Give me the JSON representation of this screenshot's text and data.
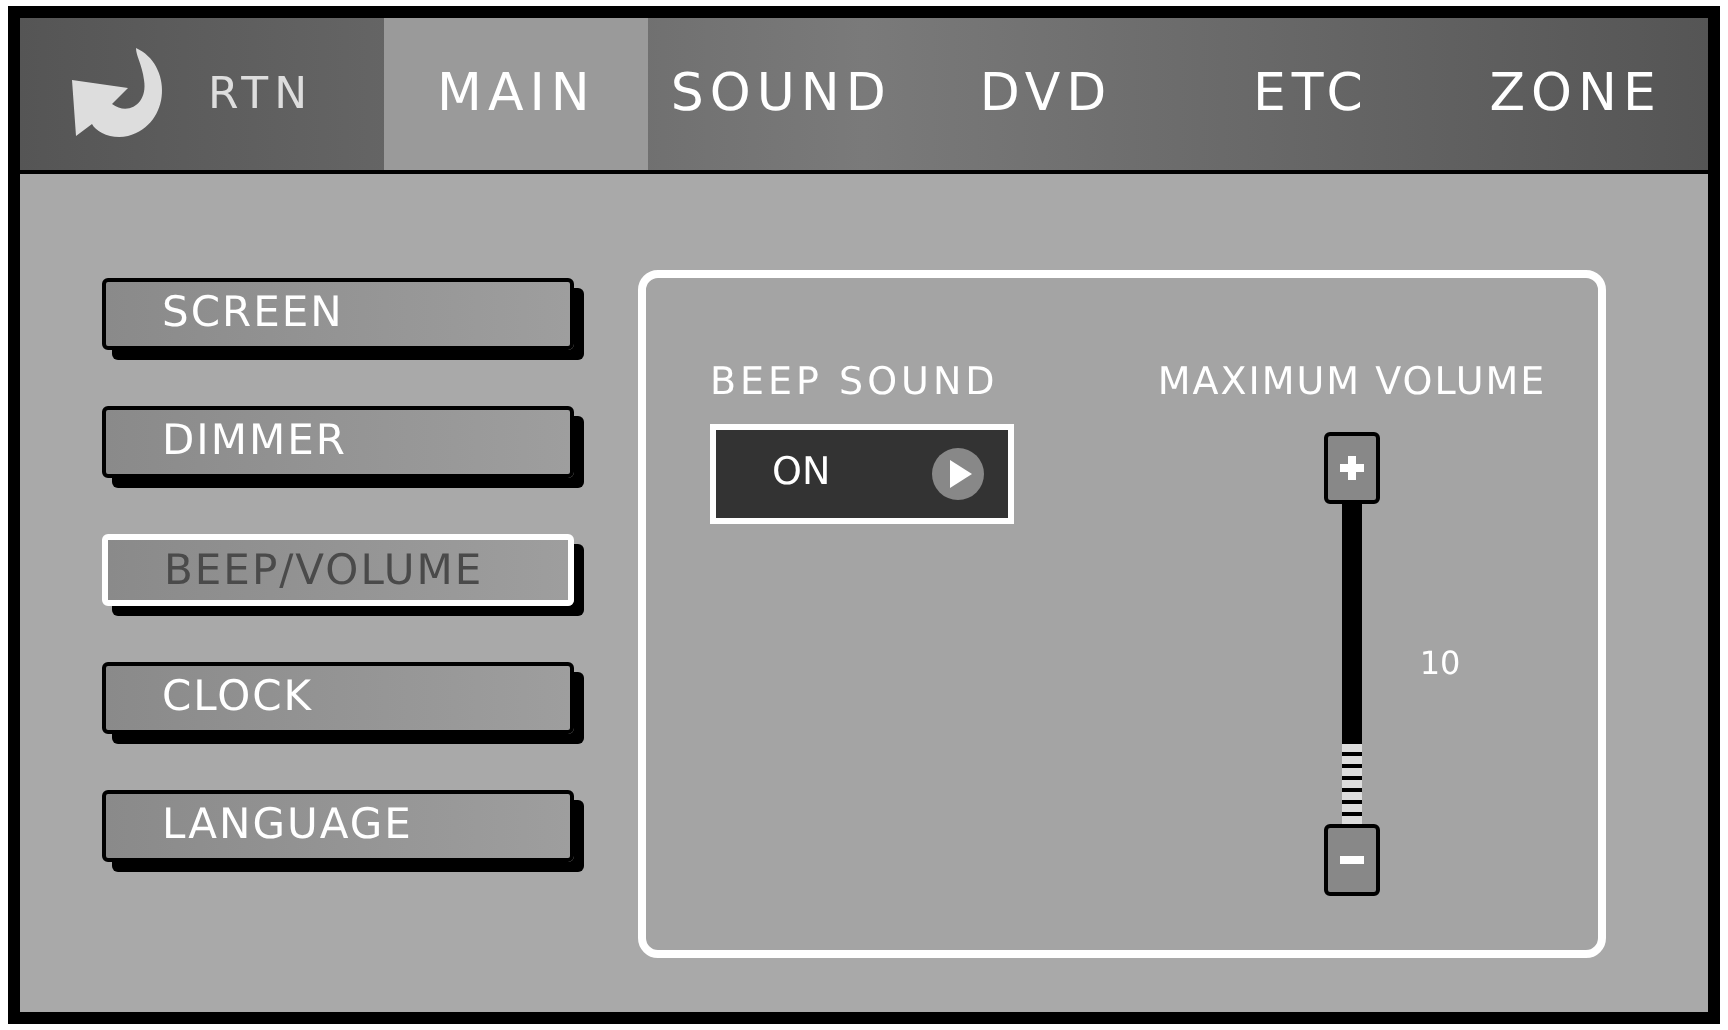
{
  "top_bar": {
    "return_label": "RTN",
    "tabs": [
      {
        "label": "MAIN",
        "selected": true
      },
      {
        "label": "SOUND",
        "selected": false
      },
      {
        "label": "DVD",
        "selected": false
      },
      {
        "label": "ETC",
        "selected": false
      },
      {
        "label": "ZONE",
        "selected": false
      }
    ]
  },
  "menu": [
    {
      "label": "SCREEN",
      "selected": false
    },
    {
      "label": "DIMMER",
      "selected": false
    },
    {
      "label": "BEEP/VOLUME",
      "selected": true
    },
    {
      "label": "CLOCK",
      "selected": false
    },
    {
      "label": "LANGUAGE",
      "selected": false
    }
  ],
  "beep_sound": {
    "title": "BEEP SOUND",
    "value": "ON"
  },
  "maximum_volume": {
    "title": "MAXIMUM VOLUME",
    "level": 0.25,
    "reading": "10"
  }
}
